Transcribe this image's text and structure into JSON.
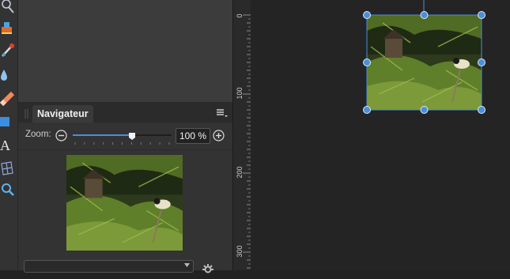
{
  "navigator": {
    "tab_label": "Navigateur",
    "zoom_label": "Zoom:",
    "zoom_value": "100 %",
    "zoom_slider_fraction": 0.6
  },
  "ruler": {
    "ticks": [
      "0",
      "100",
      "200",
      "300"
    ]
  },
  "colors": {
    "accent": "#4a8fd9",
    "panel": "#333333",
    "canvas": "#242424"
  },
  "icons": {
    "tools": [
      "crop-icon",
      "fill-icon",
      "brush-icon",
      "eyedropper-icon",
      "eraser-icon",
      "rectangle-icon",
      "text-icon",
      "mesh-icon",
      "zoom-icon"
    ],
    "zoom_out": "minus-circle-icon",
    "zoom_in": "plus-circle-icon",
    "panel_menu": "menu-icon",
    "settings": "gear-icon"
  }
}
